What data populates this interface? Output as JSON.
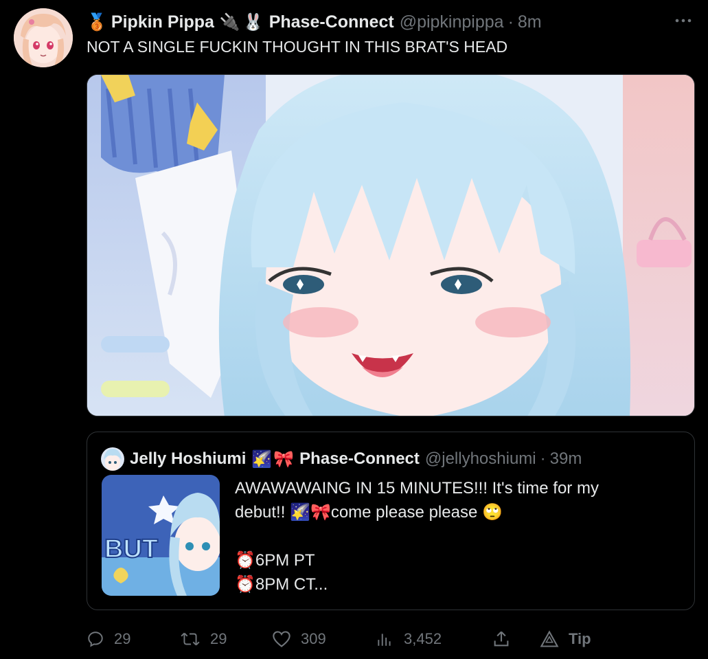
{
  "tweet": {
    "author_name": "Pipkin Pippa",
    "badge_emoji": "🥉",
    "flair_1": "🔌",
    "flair_2": "🐰",
    "org": "Phase-Connect",
    "handle": "@pipkinpippa",
    "separator": "·",
    "time": "8m",
    "text": "NOT A SINGLE FUCKIN THOUGHT IN THIS BRAT'S HEAD"
  },
  "quote": {
    "author_name": "Jelly Hoshiumi",
    "flair_1": "🌠",
    "flair_2": "🎀",
    "org": "Phase-Connect",
    "handle": "@jellyhoshiumi",
    "separator": "·",
    "time": "39m",
    "lines": [
      "AWAWAWAING IN 15 MINUTES!!! It's time for my",
      "debut!! 🌠🎀come please please 🙄",
      "",
      "⏰6PM PT",
      "⏰8PM CT..."
    ]
  },
  "actions": {
    "replies": "29",
    "reposts": "29",
    "likes": "309",
    "views": "3,452",
    "tip": "Tip"
  },
  "icons": {
    "more": "more-icon",
    "reply": "reply-icon",
    "repost": "repost-icon",
    "like": "heart-icon",
    "views": "views-icon",
    "share": "share-icon",
    "tip": "tip-icon"
  },
  "colors": {
    "background": "#000000",
    "text_primary": "#e7e9ea",
    "text_secondary": "#71767b",
    "border": "#2f3336",
    "hair": "#bfe0f2",
    "skin": "#fbe6e1"
  }
}
